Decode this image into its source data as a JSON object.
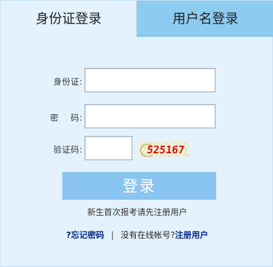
{
  "tabs": {
    "id_login": "身份证登录",
    "username_login": "用户名登录"
  },
  "form": {
    "id_label": "身份证:",
    "password_label": "密    码:",
    "captcha_label": "验证码:",
    "id_value": "",
    "password_value": "",
    "captcha_value": "",
    "captcha_text": "525167"
  },
  "login_button": "登录",
  "hint": "新生首次报考请先注册用户",
  "links": {
    "forgot": "?忘记密码",
    "separator": "|",
    "no_account": "没有在线帐号?",
    "register": "注册用户"
  },
  "colors": {
    "background": "#e3f2fc",
    "inactive_tab": "#8dcbf1",
    "button": "#8ac4f0",
    "captcha_text": "#c81818",
    "link": "#0a2a8a"
  }
}
